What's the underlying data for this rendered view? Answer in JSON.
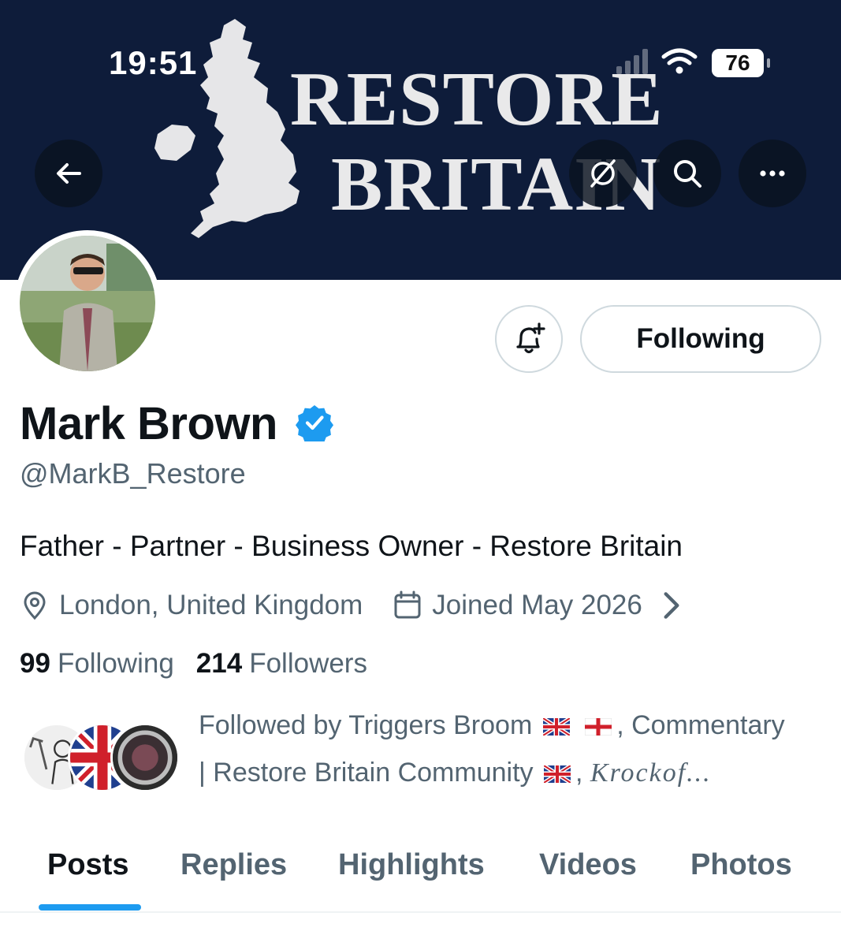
{
  "status_bar": {
    "time": "19:51",
    "battery": "76"
  },
  "banner": {
    "line1": "RESTORE",
    "line2": "BRITAIN",
    "bg_color": "#0e1c3a"
  },
  "header_buttons": {
    "back_icon": "arrow-left-icon",
    "grok_icon": "grok-icon",
    "search_icon": "search-icon",
    "more_icon": "more-horizontal-icon"
  },
  "actions": {
    "notify_icon": "bell-plus-icon",
    "follow_label": "Following"
  },
  "profile": {
    "name": "Mark Brown",
    "verified": true,
    "handle": "@MarkB_Restore",
    "bio": "Father - Partner - Business Owner - Restore Britain",
    "location": "London, United Kingdom",
    "joined": "Joined May 2026"
  },
  "stats": {
    "following_count": "99",
    "following_label": "Following",
    "followers_count": "214",
    "followers_label": "Followers"
  },
  "followed_by": {
    "prefix": "Followed by Triggers Broom",
    "middle": ", Commentary",
    "line2": "| Restore Britain Community",
    "suffix": ", ",
    "last": "Krockof..."
  },
  "tabs": [
    {
      "label": "Posts",
      "active": true
    },
    {
      "label": "Replies",
      "active": false
    },
    {
      "label": "Highlights",
      "active": false
    },
    {
      "label": "Videos",
      "active": false
    },
    {
      "label": "Photos",
      "active": false
    }
  ],
  "colors": {
    "accent": "#1d9bf0",
    "muted": "#536471",
    "text": "#0f1419"
  }
}
